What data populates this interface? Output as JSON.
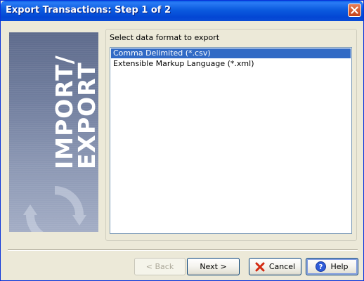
{
  "window": {
    "title": "Export Transactions: Step 1 of 2"
  },
  "banner": {
    "line1": "IMPORT/",
    "line2": "EXPORT"
  },
  "format_group": {
    "label": "Select data format to export",
    "options": [
      {
        "label": "Comma Delimited (*.csv)",
        "selected": true
      },
      {
        "label": "Extensible Markup Language (*.xml)",
        "selected": false
      }
    ]
  },
  "buttons": {
    "back_label": "< Back",
    "next_label": "Next >",
    "cancel_label": "Cancel",
    "help_label": "Help"
  },
  "icons": {
    "close": "close-icon",
    "cancel": "red-x-icon",
    "help": "question-icon"
  },
  "colors": {
    "titlebar": "#0A5FE6",
    "selection": "#316AC5",
    "dialog_bg": "#ECE9D8"
  }
}
